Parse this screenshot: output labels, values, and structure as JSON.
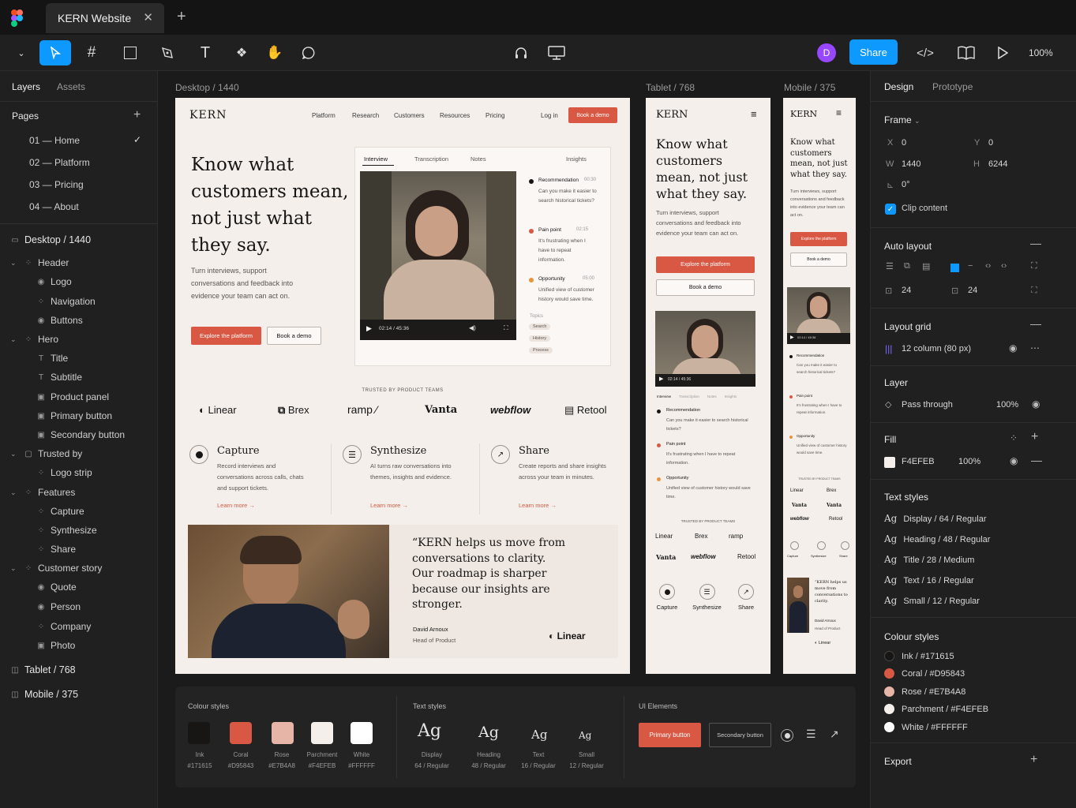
{
  "tab": {
    "title": "KERN Website"
  },
  "toolbar": {
    "share": "Share",
    "zoom": "100%",
    "avatar": "D"
  },
  "left": {
    "tabs": [
      "Layers",
      "Assets"
    ],
    "pages_label": "Pages",
    "pages": [
      "01 — Home",
      "02 — Platform",
      "03 — Pricing",
      "04 — About"
    ],
    "layers": [
      "Desktop / 1440",
      "Header",
      "Logo",
      "Navigation",
      "Buttons",
      "Hero",
      "Title",
      "Subtitle",
      "Product panel",
      "Primary button",
      "Secondary button",
      "Trusted by",
      "Logo strip",
      "Features",
      "Capture",
      "Synthesize",
      "Share",
      "Customer story",
      "Quote",
      "Person",
      "Company",
      "Photo",
      "Tablet / 768",
      "Mobile / 375"
    ]
  },
  "frames": {
    "desktop": "Desktop / 1440",
    "tablet": "Tablet / 768",
    "mobile": "Mobile / 375"
  },
  "site": {
    "brand": "KERN",
    "nav": [
      "Platform",
      "Research",
      "Customers",
      "Resources",
      "Pricing"
    ],
    "login": "Log in",
    "demo": "Book a demo",
    "title": "Know what customers mean, not just what they say.",
    "subtitle": "Turn interviews, support conversations and feedback into evidence your team can act on.",
    "primary": "Explore the platform",
    "secondary": "Book a demo",
    "panel_tabs": [
      "Interview",
      "Transcription",
      "Notes",
      "Insights"
    ],
    "time": "02:14 / 45:36",
    "insights": [
      {
        "tag": "Recommendation",
        "t": "00:30",
        "text": "Can you make it easier to search historical tickets?"
      },
      {
        "tag": "Pain point",
        "t": "02:15",
        "text": "It's frustrating when I have to repeat information."
      },
      {
        "tag": "Opportunity",
        "t": "05:00",
        "text": "Unified view of customer history would save time."
      }
    ],
    "topics_label": "Topics",
    "topics": [
      "Search",
      "History",
      "Process"
    ],
    "trusted": "TRUSTED BY PRODUCT TEAMS",
    "logos": [
      "Linear",
      "Brex",
      "ramp",
      "Vanta",
      "webflow",
      "Retool"
    ],
    "features": [
      {
        "title": "Capture",
        "text": "Record interviews and conversations across calls, chats and support tickets."
      },
      {
        "title": "Synthesize",
        "text": "AI turns raw conversations into themes, insights and evidence."
      },
      {
        "title": "Share",
        "text": "Create reports and share insights across your team in minutes."
      }
    ],
    "learn": "Learn more →",
    "quote": "“KERN helps us move from conversations to clarity. Our roadmap is sharper because our insights are stronger.",
    "person": "David Arnoux",
    "role": "Head of Product",
    "company": "Linear",
    "mobile_quote": "“KERN helps us move from conversations to clarity."
  },
  "bottom": {
    "colour_label": "Colour styles",
    "colours": [
      {
        "name": "Ink",
        "hex": "#171615"
      },
      {
        "name": "Coral",
        "hex": "#D95843"
      },
      {
        "name": "Rose",
        "hex": "#E7B4A8"
      },
      {
        "name": "Parchment",
        "hex": "#F4EFEB"
      },
      {
        "name": "White",
        "hex": "#FFFFFF"
      }
    ],
    "text_label": "Text styles",
    "texts": [
      {
        "name": "Display",
        "spec": "64 / Regular"
      },
      {
        "name": "Heading",
        "spec": "48 / Regular"
      },
      {
        "name": "Text",
        "spec": "16 / Regular"
      },
      {
        "name": "Small",
        "spec": "12 / Regular"
      }
    ],
    "ag": "Ag",
    "ui_label": "UI Elements",
    "primary": "Primary button",
    "secondary": "Secondary button"
  },
  "right": {
    "tabs": [
      "Design",
      "Prototype"
    ],
    "frame": "Frame",
    "x": "0",
    "y": "0",
    "w": "1440",
    "h": "6244",
    "rot": "0°",
    "clip": "Clip content",
    "auto_layout": "Auto layout",
    "pad1": "24",
    "pad2": "24",
    "grid": "Layout grid",
    "grid_val": "12 column (80 px)",
    "layer": "Layer",
    "blend": "Pass through",
    "opacity": "100%",
    "fill": "Fill",
    "fill_hex": "F4EFEB",
    "fill_op": "100%",
    "text_styles": "Text styles",
    "tstyles": [
      "Display / 64 / Regular",
      "Heading / 48 / Regular",
      "Title / 28 / Medium",
      "Text / 16 / Regular",
      "Small / 12 / Regular"
    ],
    "colour_styles": "Colour styles",
    "cstyles": [
      "Ink / #171615",
      "Coral / #D95843",
      "Rose / #E7B4A8",
      "Parchment / #F4EFEB",
      "White / #FFFFFF"
    ],
    "export": "Export"
  }
}
